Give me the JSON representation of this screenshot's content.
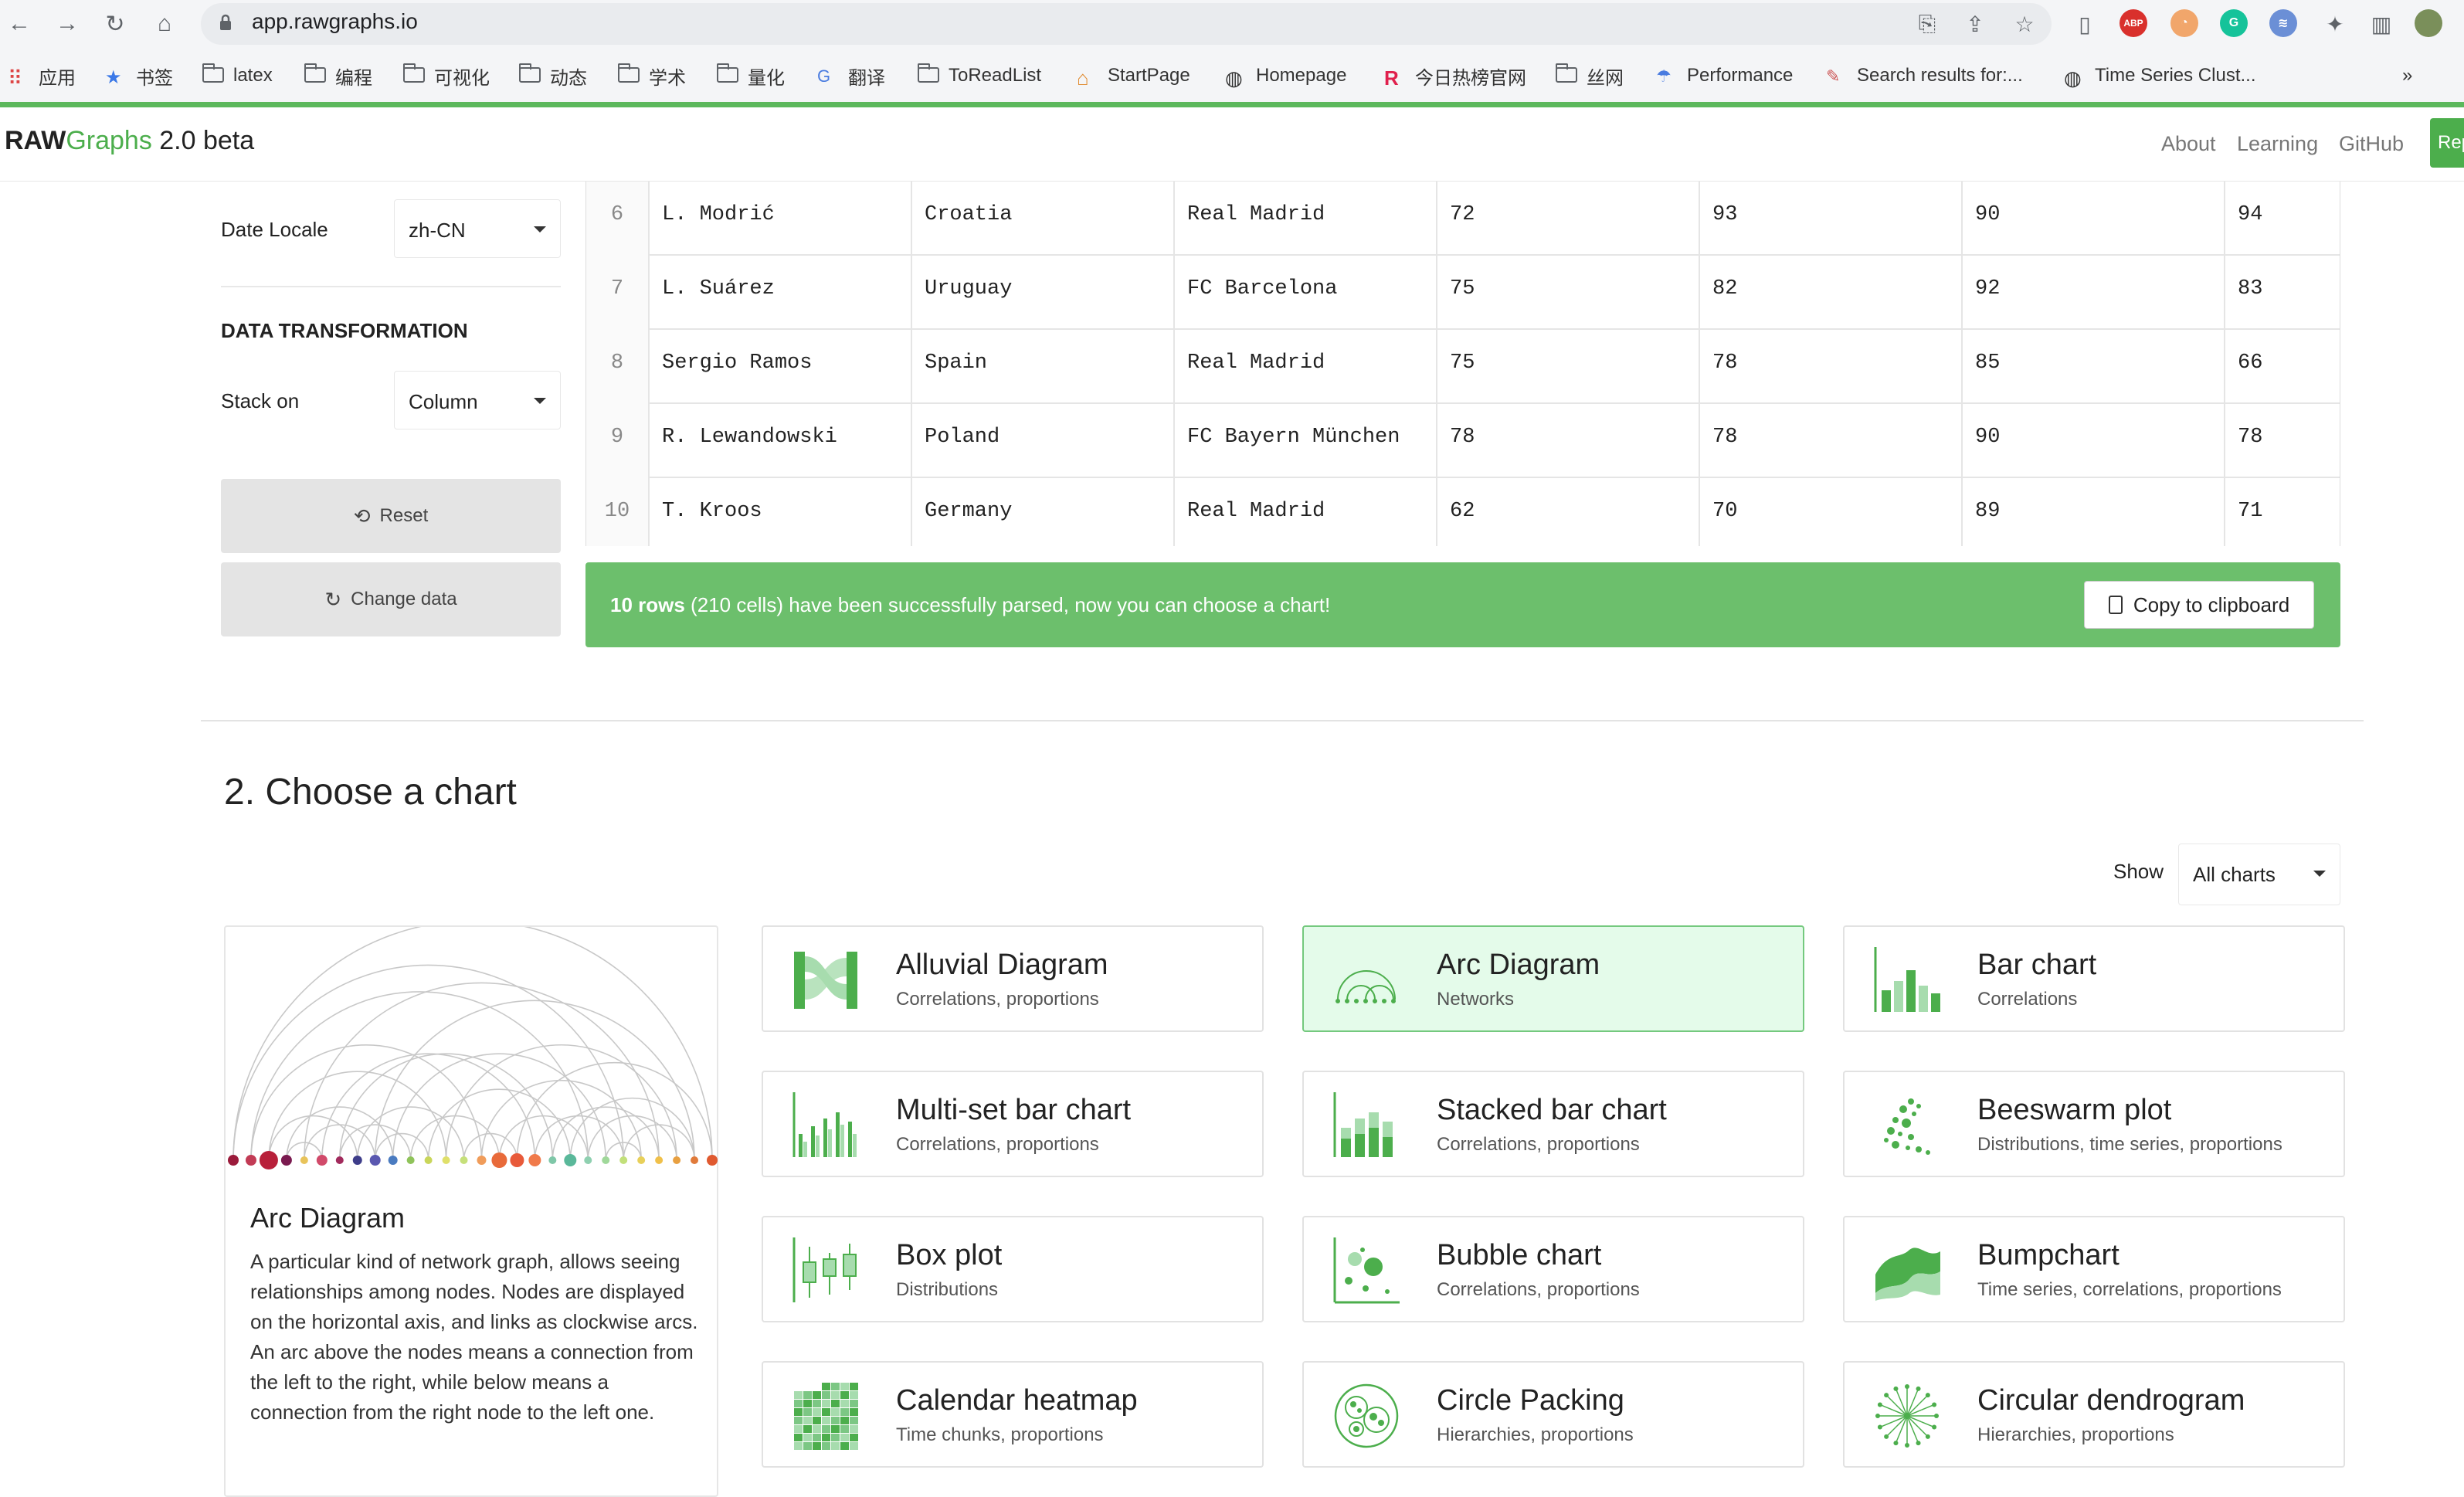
{
  "browser": {
    "url": "app.rawgraphs.io",
    "bookmarks": [
      {
        "label": "应用",
        "icon": "apps-grid-icon"
      },
      {
        "label": "书签",
        "icon": "star-icon"
      },
      {
        "label": "latex",
        "icon": "folder-icon"
      },
      {
        "label": "编程",
        "icon": "folder-icon"
      },
      {
        "label": "可视化",
        "icon": "folder-icon"
      },
      {
        "label": "动态",
        "icon": "folder-icon"
      },
      {
        "label": "学术",
        "icon": "folder-icon"
      },
      {
        "label": "量化",
        "icon": "folder-icon"
      },
      {
        "label": "翻译",
        "icon": "translate-icon"
      },
      {
        "label": "ToReadList",
        "icon": "folder-icon"
      },
      {
        "label": "StartPage",
        "icon": "home-icon"
      },
      {
        "label": "Homepage",
        "icon": "globe-icon"
      },
      {
        "label": "今日热榜官网",
        "icon": "r-logo-icon"
      },
      {
        "label": "丝网",
        "icon": "folder-icon"
      },
      {
        "label": "Performance",
        "icon": "weather-icon"
      },
      {
        "label": "Search results for:...",
        "icon": "book-icon"
      },
      {
        "label": "Time Series Clust...",
        "icon": "globe-icon"
      }
    ],
    "more_bookmarks": "»"
  },
  "app": {
    "brand_raw": "RAW",
    "brand_graphs": "Graphs",
    "brand_version": " 2.0 beta",
    "nav": [
      "About",
      "Learning",
      "GitHub"
    ],
    "repo_button": "Rep"
  },
  "settings": {
    "date_locale_label": "Date Locale",
    "date_locale_value": "zh-CN",
    "transformation_heading": "DATA TRANSFORMATION",
    "stack_on_label": "Stack on",
    "stack_on_value": "Column",
    "reset_label": "Reset",
    "change_data_label": "Change data"
  },
  "table": {
    "rows": [
      [
        "6",
        "L. Modrić",
        "Croatia",
        "Real Madrid",
        "72",
        "93",
        "90",
        "94"
      ],
      [
        "7",
        "L. Suárez",
        "Uruguay",
        "FC Barcelona",
        "75",
        "82",
        "92",
        "83"
      ],
      [
        "8",
        "Sergio Ramos",
        "Spain",
        "Real Madrid",
        "75",
        "78",
        "85",
        "66"
      ],
      [
        "9",
        "R. Lewandowski",
        "Poland",
        "FC Bayern München",
        "78",
        "78",
        "90",
        "78"
      ],
      [
        "10",
        "T. Kroos",
        "Germany",
        "Real Madrid",
        "62",
        "70",
        "89",
        "71"
      ]
    ]
  },
  "parse": {
    "rows_bold": "10 rows",
    "message_rest": " (210 cells) have been successfully parsed, now you can choose a chart!",
    "copy_label": "Copy to clipboard"
  },
  "choose": {
    "title": "2. Choose a chart",
    "show_label": "Show",
    "show_value": "All charts"
  },
  "preview": {
    "title": "Arc Diagram",
    "description": "A particular kind of network graph, allows seeing relationships among nodes. Nodes are displayed on the horizontal axis, and links as clockwise arcs. An arc above the nodes means a connection from the left to the right, while below means a connection from the right node to the left one."
  },
  "charts": [
    {
      "title": "Alluvial Diagram",
      "subtitle": "Correlations, proportions",
      "icon": "alluvial-icon"
    },
    {
      "title": "Arc Diagram",
      "subtitle": "Networks",
      "icon": "arc-icon"
    },
    {
      "title": "Bar chart",
      "subtitle": "Correlations",
      "icon": "bar-icon"
    },
    {
      "title": "Multi-set bar chart",
      "subtitle": "Correlations, proportions",
      "icon": "multiset-bar-icon"
    },
    {
      "title": "Stacked bar chart",
      "subtitle": "Correlations, proportions",
      "icon": "stacked-bar-icon"
    },
    {
      "title": "Beeswarm plot",
      "subtitle": "Distributions, time series, proportions",
      "icon": "beeswarm-icon"
    },
    {
      "title": "Box plot",
      "subtitle": "Distributions",
      "icon": "boxplot-icon"
    },
    {
      "title": "Bubble chart",
      "subtitle": "Correlations, proportions",
      "icon": "bubble-icon"
    },
    {
      "title": "Bumpchart",
      "subtitle": "Time series, correlations, proportions",
      "icon": "bump-icon"
    },
    {
      "title": "Calendar heatmap",
      "subtitle": "Time chunks, proportions",
      "icon": "calendar-icon"
    },
    {
      "title": "Circle Packing",
      "subtitle": "Hierarchies, proportions",
      "icon": "circle-packing-icon"
    },
    {
      "title": "Circular dendrogram",
      "subtitle": "Hierarchies, proportions",
      "icon": "dendrogram-icon"
    }
  ],
  "colors": {
    "accent": "#4cae4c",
    "success_bar": "#6cbf6c",
    "selected_card": "#e4fbea"
  }
}
